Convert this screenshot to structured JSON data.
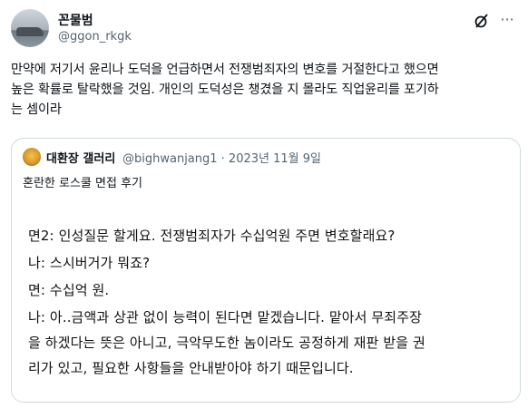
{
  "author": {
    "name": "꼰물범",
    "handle": "@ggon_rkgk"
  },
  "icons": {
    "grok": "grok-icon",
    "more": "more-icon"
  },
  "tweet": {
    "text": "만약에 저기서 윤리나 도덕을 언급하면서 전쟁범죄자의 변호를 거절한다고 했으면\n높은 확률로 탈락했을 것임. 개인의 도덕성은 챙겼을 지 몰라도 직업윤리를 포기하\n는 셈이라"
  },
  "quote": {
    "name": "대환장 갤러리",
    "meta": "@bighwanjang1 · 2023년 11월 9일",
    "text": "혼란한 로스쿨 면접 후기",
    "image_lines": [
      "면2: 인성질문 할게요. 전쟁범죄자가 수십억원 주면 변호할래요?",
      "나: 스시버거가 뭐죠?",
      "면: 수십억 원.",
      "나: 아..금액과 상관 없이 능력이 된다면 맡겠습니다. 맡아서 무죄주장",
      "을 하겠다는 뜻은 아니고, 극악무도한 놈이라도 공정하게 재판 받을 권",
      "리가 있고, 필요한 사항들을 안내받아야 하기 때문입니다."
    ]
  }
}
